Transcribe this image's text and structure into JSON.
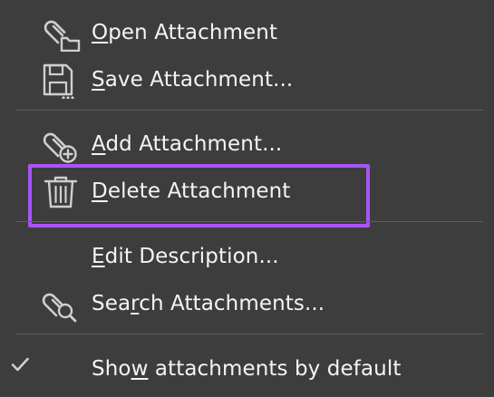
{
  "menu": {
    "items": [
      {
        "pre": "",
        "ul": "O",
        "post": "pen Attachment",
        "icon": "attachment-folder-icon"
      },
      {
        "pre": "",
        "ul": "S",
        "post": "ave Attachment...",
        "icon": "save-disk-icon"
      },
      {
        "pre": "",
        "ul": "A",
        "post": "dd Attachment...",
        "icon": "attachment-add-icon"
      },
      {
        "pre": "",
        "ul": "D",
        "post": "elete Attachment",
        "icon": "trash-icon"
      },
      {
        "pre": "",
        "ul": "E",
        "post": "dit Description...",
        "icon": ""
      },
      {
        "pre": "Sea",
        "ul": "r",
        "post": "ch Attachments...",
        "icon": "attachment-search-icon"
      },
      {
        "pre": "Sho",
        "ul": "w",
        "post": " attachments by default",
        "icon": "checkmark-icon",
        "checked": true
      }
    ]
  },
  "colors": {
    "background": "#3d3d3d",
    "text": "#f4f4f4",
    "icon": "#cfcfcf",
    "separator": "#5f5f5f",
    "highlight": "#a855f7"
  }
}
